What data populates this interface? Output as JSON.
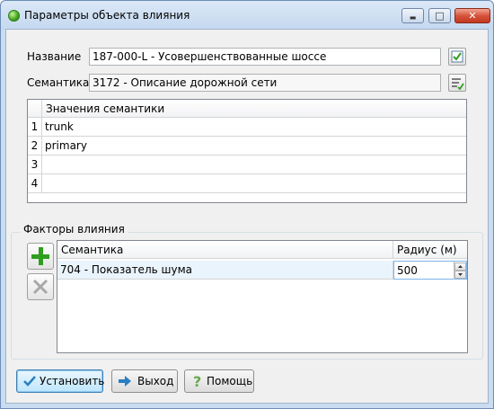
{
  "window": {
    "title": "Параметры объекта влияния",
    "minimize_glyph": "▬",
    "maximize_glyph": "□",
    "close_glyph": "✕"
  },
  "form": {
    "name_label": "Название",
    "name_value": "187-000-L - Усовершенствованные шоссе",
    "semantics_label": "Семантика",
    "semantics_value": "3172 - Описание дорожной сети"
  },
  "semantic_values": {
    "header": "Значения семантики",
    "rows": [
      {
        "num": "1",
        "value": "trunk"
      },
      {
        "num": "2",
        "value": "primary"
      },
      {
        "num": "3",
        "value": ""
      },
      {
        "num": "4",
        "value": ""
      }
    ]
  },
  "factors": {
    "title": "Факторы влияния",
    "columns": {
      "semantics": "Семантика",
      "radius": "Радиус (м)"
    },
    "rows": [
      {
        "semantics": "704 - Показатель шума",
        "radius": "500"
      }
    ]
  },
  "buttons": {
    "apply": "Установить",
    "exit": "Выход",
    "help": "Помощь"
  },
  "colors": {
    "add": "#2f9e1f",
    "accent": "#3c7fb1",
    "row_highlight": "#eaf4fc"
  }
}
